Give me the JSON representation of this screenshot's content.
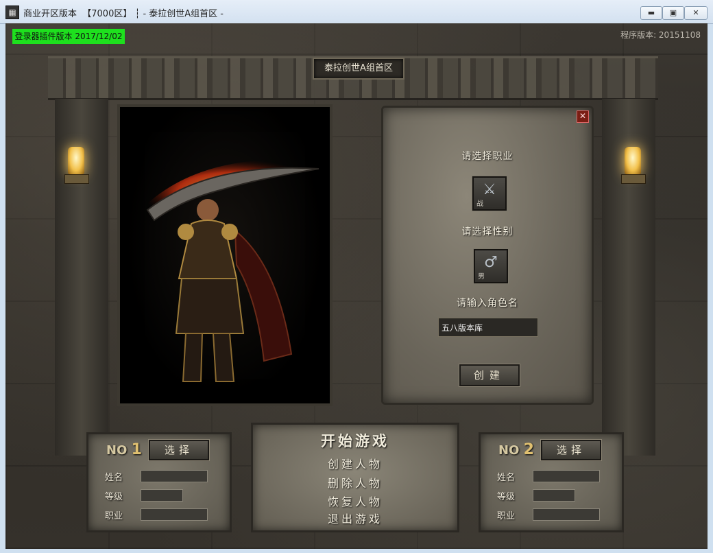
{
  "window": {
    "title": "商业开区版本  【7000区】 ┆ - 泰拉创世A组首区 -",
    "minimize": "▬",
    "maximize": "▣",
    "close": "✕"
  },
  "header": {
    "plugin_version": "登录器插件版本 2017/12/02",
    "program_version": "程序版本: 20151108",
    "server_name": "泰拉创世A组首区"
  },
  "create_panel": {
    "close": "✕",
    "choose_class": "请选择职业",
    "class_caption": "战",
    "choose_gender": "请选择性别",
    "gender_caption": "男",
    "enter_name": "请输入角色名",
    "name_value": "五八版本库",
    "create_button": "创建"
  },
  "slots": [
    {
      "no_label": "NO",
      "number": "1",
      "select": "选择",
      "name_label": "姓名",
      "level_label": "等级",
      "job_label": "职业"
    },
    {
      "no_label": "NO",
      "number": "2",
      "select": "选择",
      "name_label": "姓名",
      "level_label": "等级",
      "job_label": "职业"
    }
  ],
  "menu": {
    "start": "开始游戏",
    "create": "创建人物",
    "delete": "删除人物",
    "restore": "恢复人物",
    "exit": "退出游戏"
  },
  "colors": {
    "plugin_badge": "#1ee01e",
    "stone": "#5a564c",
    "lamp_glow": "#f2c04a"
  },
  "icons": {
    "class_icon": "sword-icon",
    "gender_icon": "male-symbol-icon"
  }
}
